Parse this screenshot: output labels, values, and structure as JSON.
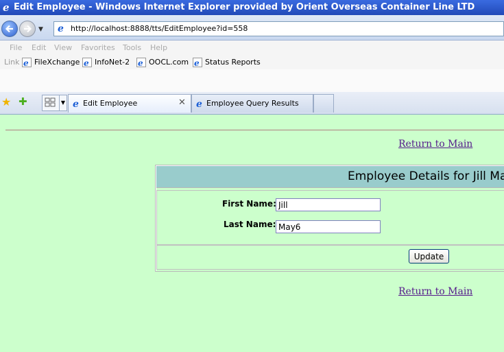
{
  "window": {
    "title": "Edit Employee - Windows Internet Explorer provided by Orient Overseas Container Line LTD"
  },
  "address_bar": {
    "url": "http://localhost:8888/tts/EditEmployee?id=558"
  },
  "menu": [
    "File",
    "Edit",
    "View",
    "Favorites",
    "Tools",
    "Help"
  ],
  "links_bar": {
    "label": "Link",
    "items": [
      "FileXchange",
      "InfoNet-2",
      "OOCL.com",
      "Status Reports"
    ]
  },
  "tabs": [
    {
      "label": "Edit Employee",
      "active": true
    },
    {
      "label": "Employee Query Results",
      "active": false
    }
  ],
  "page": {
    "return_link": "Return to Main",
    "panel_title": "Employee Details for Jill May",
    "first_name_label": "First Name:",
    "first_name_value": "Jill",
    "last_name_label": "Last Name:",
    "last_name_value": "May6",
    "update_button": "Update"
  },
  "colors": {
    "page_background": "#ccffcc",
    "panel_header": "#99cccc",
    "link": "#551a8b"
  }
}
